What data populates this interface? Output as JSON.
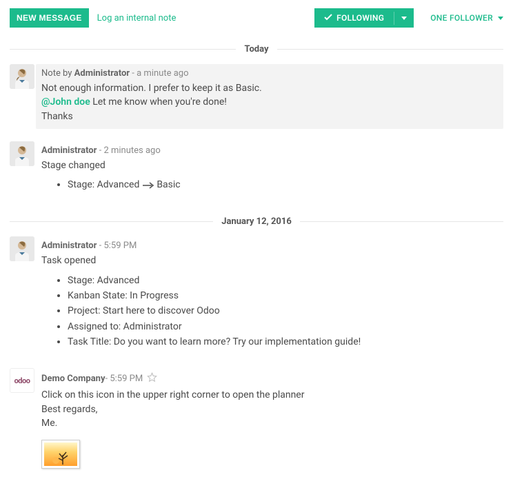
{
  "header": {
    "new_message_label": "NEW MESSAGE",
    "log_note_label": "Log an internal note",
    "following_label": "FOLLOWING",
    "follower_count_label": "ONE FOLLOWER"
  },
  "dividers": {
    "today": "Today",
    "jan12": "January 12, 2016"
  },
  "messages": {
    "note1": {
      "prefix": "Note by ",
      "author": "Administrator",
      "time": " - a minute ago",
      "line1": "Not enough information. I prefer to keep it as Basic.",
      "mention": "@John doe",
      "line2_rest": " Let me know when you're done!",
      "line3": "Thanks"
    },
    "msg2": {
      "author": "Administrator",
      "time": " - 2 minutes ago",
      "line1": "Stage changed",
      "stage_label": "Stage: ",
      "stage_from": "Advanced",
      "stage_to": "Basic"
    },
    "msg3": {
      "author": "Administrator",
      "time": " - 5:59 PM",
      "line1": "Task opened",
      "items": {
        "i0": "Stage: Advanced",
        "i1": "Kanban State: In Progress",
        "i2": "Project: Start here to discover Odoo",
        "i3": "Assigned to: Administrator",
        "i4": "Task Title: Do you want to learn more? Try our implementation guide!"
      }
    },
    "msg4": {
      "author": "Demo Company",
      "time": " - 5:59 PM",
      "line1": "Click on this icon in the upper right corner to open the planner",
      "line2": "Best regards,",
      "line3": "Me."
    }
  },
  "avatar_odoo_label": "odoo"
}
